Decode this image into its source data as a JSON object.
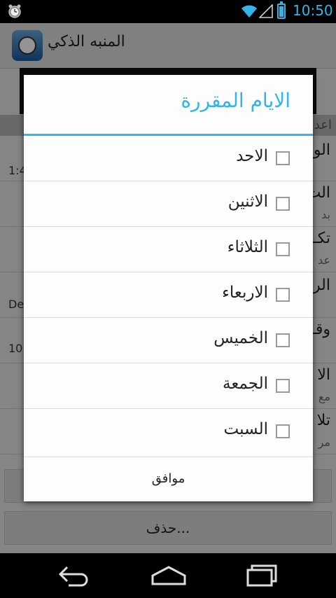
{
  "status_bar": {
    "time": "10:50"
  },
  "action_bar": {
    "title": "المنبه الذكي"
  },
  "background": {
    "section_header": "اعد",
    "rows": [
      {
        "title": "الو",
        "sub": "",
        "left_value": "1:4"
      },
      {
        "title": "الت",
        "sub": "بد",
        "left_value": ""
      },
      {
        "title": "تكـ",
        "sub": "عد",
        "left_value": ""
      },
      {
        "title": "الر",
        "sub": "",
        "left_value": "De"
      },
      {
        "title": "وقـ",
        "sub": "",
        "left_value": "10"
      },
      {
        "title": "الا",
        "sub": "مع",
        "left_value": ""
      },
      {
        "title": "تلا",
        "sub": "مر",
        "left_value": ""
      }
    ],
    "button_1": "",
    "button_2": "حذف..."
  },
  "dialog": {
    "title": "الايام المقررة",
    "days": [
      {
        "label": "الاحد",
        "checked": false
      },
      {
        "label": "الاثنين",
        "checked": false
      },
      {
        "label": "الثلاثاء",
        "checked": false
      },
      {
        "label": "الاربعاء",
        "checked": false
      },
      {
        "label": "الخميس",
        "checked": false
      },
      {
        "label": "الجمعة",
        "checked": false
      },
      {
        "label": "السبت",
        "checked": false
      }
    ],
    "ok_label": "موافق"
  },
  "colors": {
    "accent": "#33b5e5",
    "dialog_bg": "#fdfdfd",
    "screen_bg": "#e6e6e6"
  },
  "icons": {
    "status": [
      "alarm-clock-icon",
      "wifi-icon",
      "signal-icon",
      "battery-charging-icon"
    ],
    "nav": [
      "back-icon",
      "home-icon",
      "recent-apps-icon"
    ]
  }
}
